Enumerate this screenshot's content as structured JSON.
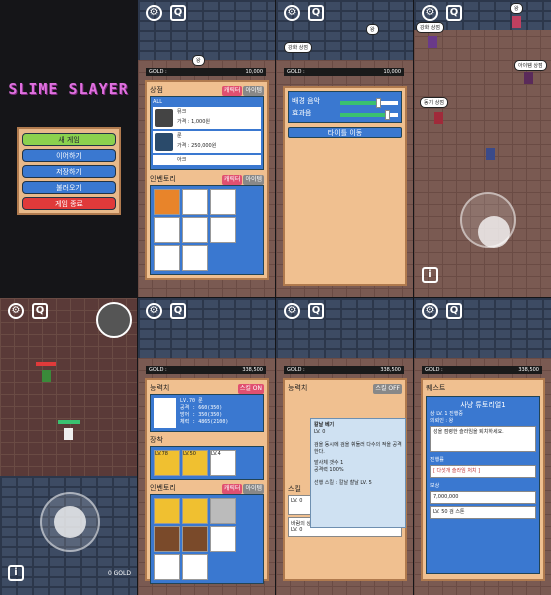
{
  "title_screen": {
    "title": "SLIME SLAYER",
    "menu": [
      {
        "label": "새 게임",
        "color": "#8bd14e"
      },
      {
        "label": "이어하기",
        "color": "#3a78d0"
      },
      {
        "label": "저장하기",
        "color": "#3a78d0"
      },
      {
        "label": "불러오기",
        "color": "#3a78d0"
      },
      {
        "label": "게임 종료",
        "color": "#e03a3a"
      }
    ]
  },
  "hud": {
    "gear_icon": "gear-icon",
    "quest_icon": "quest-icon",
    "gold_label": "GOLD :",
    "gold_value": "10,000",
    "gold_value_b": "338,500",
    "bottom_gold": "0 GOLD",
    "info_icon": "i"
  },
  "npc_labels": {
    "king": "왕",
    "weapon_shop": "강화 상점",
    "item_shop": "아이템 상점",
    "pet_shop": "동기 상점"
  },
  "shop": {
    "title": "상점",
    "tab_character": "캐릭터",
    "tab_item": "아이템",
    "filter_all": "ALL",
    "items": [
      {
        "name": "뮤크",
        "price": "가격 : 1,000원"
      },
      {
        "name": "룬",
        "price": "가격 : 250,000원"
      },
      {
        "name": "아크",
        "price": ""
      }
    ]
  },
  "inventory": {
    "title": "인벤토리",
    "tab_character": "캐릭터",
    "tab_item": "아이템"
  },
  "settings": {
    "bgm": "배경 음악",
    "sfx": "효과음",
    "title_btn": "타이틀 이동",
    "bgm_level": 0.65,
    "sfx_level": 0.8
  },
  "stats": {
    "title": "능력치",
    "skill_on": "스킬 ON",
    "skill_off": "스킬 OFF",
    "level": "LV.70",
    "name": "룬",
    "attack": "공격 : 660(350)",
    "defense": "방어 : 350(350)",
    "health": "체력 : 4865(2100)",
    "class": "[백샷]",
    "equip_title": "장착",
    "equip_levels": [
      "LV.78",
      "LV.50",
      "LV.4"
    ],
    "inv_levels": [
      "LV.5",
      "LV.8",
      "LV.4",
      "LV.6",
      "LV.3"
    ]
  },
  "skill_tooltip": {
    "title": "칼날 베기",
    "level": "LV. 0",
    "desc": "검을 동시에 검을 휘둘러 다수의 적을 공격한다.",
    "cast": "발사체 갯수 1",
    "attack": "공격력 100%",
    "pre": "선행 스킬 : 칼날 찰날 LV. 5",
    "skill_title": "스킬",
    "rows": [
      {
        "lv": "LV. 0",
        "name": ""
      },
      {
        "lv": "LV. 0",
        "name": ""
      },
      {
        "lv": "LV. 0",
        "name": "바람의 상처"
      }
    ]
  },
  "quest": {
    "title": "퀘스트",
    "quest_name": "사냥 튜토리얼1",
    "quest_lv": "상 LV. 1 진행중",
    "quest_sub": "의뢰인 : 왕",
    "desc": "성을 점령한 슬라임을 퇴치하세요.",
    "goal_label": "진행률",
    "goal": "[ 다섯개 슬라임 처치 ]",
    "reward_label": "보상",
    "reward1": "7,000,000",
    "reward2": "LV. 50 검 스톤"
  }
}
